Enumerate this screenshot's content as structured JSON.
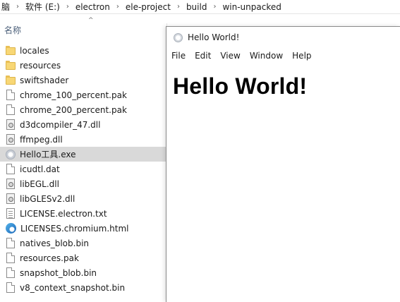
{
  "explorer": {
    "breadcrumb": [
      "脑",
      "软件 (E:)",
      "electron",
      "ele-project",
      "build",
      "win-unpacked"
    ],
    "breadcrumb_separator": "›",
    "columns": {
      "name": "名称",
      "sort_indicator": "^"
    },
    "files": [
      {
        "name": "locales",
        "icon": "folder-icon",
        "selected": false
      },
      {
        "name": "resources",
        "icon": "folder-icon",
        "selected": false
      },
      {
        "name": "swiftshader",
        "icon": "folder-icon",
        "selected": false
      },
      {
        "name": "chrome_100_percent.pak",
        "icon": "file-icon",
        "selected": false
      },
      {
        "name": "chrome_200_percent.pak",
        "icon": "file-icon",
        "selected": false
      },
      {
        "name": "d3dcompiler_47.dll",
        "icon": "dll-icon",
        "selected": false
      },
      {
        "name": "ffmpeg.dll",
        "icon": "dll-icon",
        "selected": false
      },
      {
        "name": "Hello工具.exe",
        "icon": "app-icon",
        "selected": true
      },
      {
        "name": "icudtl.dat",
        "icon": "file-icon",
        "selected": false
      },
      {
        "name": "libEGL.dll",
        "icon": "dll-icon",
        "selected": false
      },
      {
        "name": "libGLESv2.dll",
        "icon": "dll-icon",
        "selected": false
      },
      {
        "name": "LICENSE.electron.txt",
        "icon": "text-icon",
        "selected": false
      },
      {
        "name": "LICENSES.chromium.html",
        "icon": "browser-icon",
        "selected": false
      },
      {
        "name": "natives_blob.bin",
        "icon": "file-icon",
        "selected": false
      },
      {
        "name": "resources.pak",
        "icon": "file-icon",
        "selected": false
      },
      {
        "name": "snapshot_blob.bin",
        "icon": "file-icon",
        "selected": false
      },
      {
        "name": "v8_context_snapshot.bin",
        "icon": "file-icon",
        "selected": false
      }
    ]
  },
  "app_window": {
    "title": "Hello World!",
    "menu": [
      "File",
      "Edit",
      "View",
      "Window",
      "Help"
    ],
    "heading": "Hello World!"
  },
  "colors": {
    "selection": "#d9d9d9",
    "folder": "#f8d775",
    "column_header_text": "#4c607a"
  }
}
